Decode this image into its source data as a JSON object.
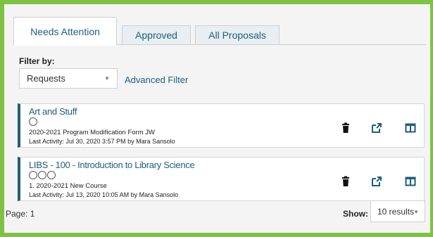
{
  "tabs": [
    {
      "label": "Needs Attention",
      "active": true
    },
    {
      "label": "Approved",
      "active": false
    },
    {
      "label": "All Proposals",
      "active": false
    }
  ],
  "filter": {
    "label": "Filter by:",
    "selected": "Requests",
    "advanced_link": "Advanced Filter"
  },
  "proposals": [
    {
      "title": "Art and Stuff",
      "circles": 1,
      "subtitle": "2020-2021 Program Modification Form JW",
      "activity": "Last Activity:   Jul 30, 2020 3:57 PM by Mara Sansolo"
    },
    {
      "title": "LIBS - 100 - Introduction to Library Science",
      "circles": 3,
      "subtitle": "1. 2020-2021 New Course",
      "activity": "Last Activity:   Jul 13, 2020 10:05 AM by Mara Sansolo"
    }
  ],
  "icons": {
    "delete": "trash-icon",
    "open": "external-link-icon",
    "split": "split-view-icon"
  },
  "footer": {
    "page_label": "Page:  1",
    "show_label": "Show:",
    "show_selected": "10 results"
  },
  "colors": {
    "frame_green": "#7dc243",
    "accent_blue": "#1d5e80",
    "card_border": "#1f5f7a"
  }
}
